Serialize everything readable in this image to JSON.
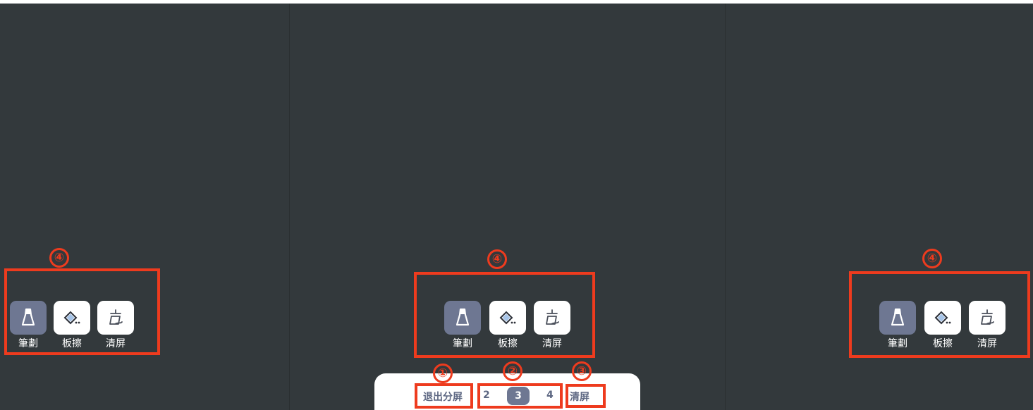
{
  "toolbar": {
    "pen_label": "筆劃",
    "eraser_label": "板擦",
    "clear_label": "清屏"
  },
  "annotations": {
    "m1": "①",
    "m2": "②",
    "m3": "③",
    "m4": "④"
  },
  "bottom_bar": {
    "exit_split_label": "退出分屏",
    "pages": [
      "2",
      "3",
      "4"
    ],
    "active_page": "3",
    "clear_screen_label": "清屏"
  },
  "colors": {
    "canvas_bg": "#33393c",
    "accent": "#6e7792",
    "annotation_red": "#ee3b1e"
  }
}
